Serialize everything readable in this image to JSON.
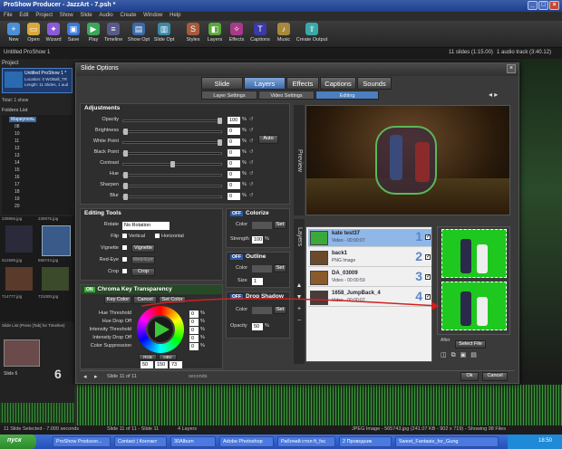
{
  "window": {
    "title": "ProShow Producer - JazzArt - 7.psh *"
  },
  "menu": [
    "File",
    "Edit",
    "Project",
    "Show",
    "Slide",
    "Audio",
    "Create",
    "Window",
    "Help"
  ],
  "toolbar": [
    "New",
    "Open",
    "Wizard",
    "Save",
    "Play",
    "Timeline",
    "Show Opt",
    "Slide Opt",
    "Styles",
    "Layers",
    "Effects",
    "Captions",
    "Music",
    "Create Output"
  ],
  "project": {
    "name": "Untitled ProShow 1",
    "info": "11 slides (1:15.00)",
    "track": "1 audio track (3:40.12)"
  },
  "left": {
    "project_label": "Project",
    "show_name": "Untitled ProShow 1 *",
    "show_info": [
      "Location: 0 WOBall_TR",
      "Length: 11 Slides, 1 aud"
    ],
    "total": "Total: 1 show",
    "folders_label": "Folders List",
    "folders": [
      "Мариуполь",
      "08",
      "10",
      "11",
      "12",
      "13",
      "14",
      "15",
      "16",
      "17",
      "18",
      "19",
      "20"
    ],
    "files": [
      "239855.jpg",
      "239875.jpg",
      "512599.jpg",
      "565743.jpg",
      "714777.jpg",
      "731000.jpg"
    ],
    "slide_list_label": "Slide List (Press [Tab] for Timeline)",
    "slide_label": "Slide 6",
    "slide_num": "6"
  },
  "dialog": {
    "title": "Slide Options",
    "tabs": [
      "Slide",
      "Layers",
      "Effects",
      "Captions",
      "Sounds"
    ],
    "active_tab": "Layers",
    "subtabs": [
      "Layer Settings",
      "Video Settings",
      "Editing"
    ],
    "active_subtab": "Editing",
    "adjustments": {
      "title": "Adjustments",
      "rows": [
        {
          "label": "Opacity",
          "value": "100",
          "unit": "%"
        },
        {
          "label": "Brightness",
          "value": "0",
          "unit": "%"
        },
        {
          "label": "White Point",
          "value": "0",
          "unit": "%"
        },
        {
          "label": "Black Point",
          "value": "0",
          "unit": "%"
        },
        {
          "label": "Contrast",
          "value": "0",
          "unit": "%"
        },
        {
          "label": "Hue",
          "value": "0",
          "unit": "%"
        },
        {
          "label": "Sharpen",
          "value": "0",
          "unit": "%"
        },
        {
          "label": "Blur",
          "value": "0",
          "unit": "%"
        }
      ],
      "auto_label": "Auto"
    },
    "editing_tools": {
      "title": "Editing Tools",
      "rotate_label": "Rotate",
      "rotate_value": "No Rotation",
      "flip_label": "Flip",
      "vertical": "Vertical",
      "horizontal": "Horizontal",
      "vignette_label": "Vignette",
      "vignette_btn": "Vignette",
      "redeye_label": "Red-Eye",
      "redeye_btn": "Red-Eye",
      "crop_label": "Crop",
      "crop_btn": "Crop"
    },
    "colorize": {
      "off": "OFF",
      "title": "Colorize",
      "color_label": "Color",
      "set": "Set",
      "strength_label": "Strength",
      "strength_value": "100",
      "unit": "%"
    },
    "outline": {
      "off": "OFF",
      "title": "Outline",
      "color_label": "Color",
      "set": "Set",
      "size_label": "Size",
      "size_value": "1"
    },
    "drop_shadow": {
      "off": "OFF",
      "title": "Drop Shadow",
      "color_label": "Color",
      "set": "Set",
      "opacity_label": "Opacity",
      "opacity_value": "50",
      "unit": "%"
    },
    "chroma": {
      "on": "ON",
      "title": "Chroma Key Transparency",
      "key_color": "Key Color",
      "cancel": "Cancel",
      "set_color": "Set Color",
      "rows": [
        {
          "label": "Hue Threshold",
          "value": "0",
          "unit": "%"
        },
        {
          "label": "Hue Drop Off",
          "value": "0",
          "unit": "%"
        },
        {
          "label": "Intensity Threshold",
          "value": "0",
          "unit": "%"
        },
        {
          "label": "Intensity Drop Off",
          "value": "0",
          "unit": "%"
        },
        {
          "label": "Color Suppression",
          "value": "0",
          "unit": "%"
        }
      ],
      "rgb": "RGB",
      "hbv": "HBV",
      "values": [
        "50",
        "150",
        "73"
      ]
    },
    "preview_label": "Preview",
    "layers_label": "Layers",
    "layers": [
      {
        "name": "kate test37",
        "sub": "Video - 00:00:07",
        "num": "1",
        "checked": true
      },
      {
        "name": "back1",
        "sub": "PNG Image",
        "num": "2",
        "checked": true
      },
      {
        "name": "DA_03009",
        "sub": "Video - 00:00:59",
        "num": "3",
        "checked": true
      },
      {
        "name": "1658_JumpBack_4",
        "sub": "Video - 00:00:07",
        "num": "4",
        "checked": true
      }
    ],
    "after_label": "After",
    "select_file": "Select File",
    "slide_nav": "Slide 11 of 11",
    "seconds": "seconds",
    "ok": "Ok",
    "cancel": "Cancel"
  },
  "status": {
    "left": "11 Slide Selected - 7.000 seconds",
    "mid": "Slide 11 of 11 - Slide 11",
    "layers": "4 Layers",
    "right": "JPEG Image - 565743.jpg (241.07 KB - 902 x 719) - Showing 98 Files"
  },
  "taskbar": {
    "start": "пуск",
    "items": [
      "ProShow Producer...",
      "Contact | Контакт",
      "30Album",
      "Adobe Photoshop",
      "Рабочий стол ft_fsc",
      "2 Проводник",
      "Sweet_Fantasie_for_Gung"
    ],
    "clock": "18:50"
  },
  "colors": {
    "accent": "#4a7fc0",
    "dialog_bg": "#3a3a3a",
    "chroma_green": "#00a000"
  }
}
